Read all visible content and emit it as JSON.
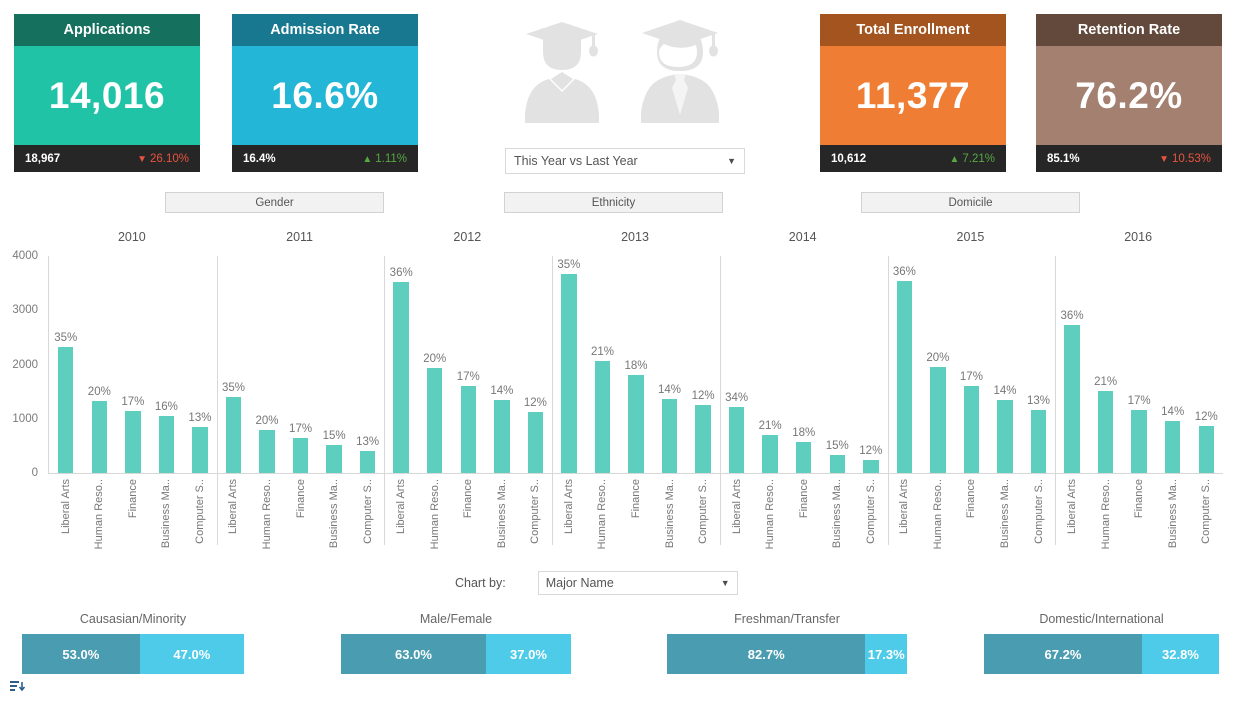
{
  "kpis": [
    {
      "title": "Applications",
      "value": "14,016",
      "prev": "18,967",
      "delta": "26.10%",
      "direction": "down",
      "head_color": "#15715e",
      "body_color": "#21c3a6",
      "delta_color": "#e8543f"
    },
    {
      "title": "Admission Rate",
      "value": "16.6%",
      "prev": "16.4%",
      "delta": "1.11%",
      "direction": "up",
      "head_color": "#17788f",
      "body_color": "#23b6d6",
      "delta_color": "#57a843"
    },
    {
      "title": "Total Enrollment",
      "value": "11,377",
      "prev": "10,612",
      "delta": "7.21%",
      "direction": "up",
      "head_color": "#a4541e",
      "body_color": "#f07d34",
      "delta_color": "#57a843"
    },
    {
      "title": "Retention Rate",
      "value": "76.2%",
      "prev": "85.1%",
      "delta": "10.53%",
      "direction": "down",
      "head_color": "#62493c",
      "body_color": "#a38070",
      "delta_color": "#e8543f"
    }
  ],
  "period_select": {
    "value": "This Year vs Last Year",
    "caret": "chevron-down-icon"
  },
  "filters": [
    {
      "label": "Gender"
    },
    {
      "label": "Ethnicity"
    },
    {
      "label": "Domicile"
    }
  ],
  "chart_by": {
    "label": "Chart by:",
    "value": "Major Name"
  },
  "splits": [
    {
      "title": "Causasian/Minority",
      "left_label": "53.0%",
      "right_label": "47.0%",
      "left_pct": 53.0,
      "right_pct": 47.0
    },
    {
      "title": "Male/Female",
      "left_label": "63.0%",
      "right_label": "37.0%",
      "left_pct": 63.0,
      "right_pct": 37.0
    },
    {
      "title": "Freshman/Transfer",
      "left_label": "82.7%",
      "right_label": "17.3%",
      "left_pct": 82.7,
      "right_pct": 17.3
    },
    {
      "title": "Domestic/International",
      "left_label": "67.2%",
      "right_label": "32.8%",
      "left_pct": 67.2,
      "right_pct": 32.8
    }
  ],
  "split_colors": {
    "left": "#4a9cb0",
    "right": "#4ecbe8"
  },
  "chart_data": {
    "type": "bar",
    "title": "",
    "xlabel": "",
    "ylabel": "",
    "ylim": [
      0,
      4000
    ],
    "yticks": [
      0,
      1000,
      2000,
      3000,
      4000
    ],
    "grid": false,
    "legend": "none",
    "bar_color": "#5ecfbe",
    "categories": [
      "Liberal Arts",
      "Human Reso..",
      "Finance",
      "Business Ma..",
      "Computer S.."
    ],
    "groups": [
      {
        "year": "2010",
        "values": [
          2330,
          1320,
          1140,
          1050,
          850
        ],
        "labels": [
          "35%",
          "20%",
          "17%",
          "16%",
          "13%"
        ]
      },
      {
        "year": "2011",
        "values": [
          1410,
          790,
          650,
          520,
          400
        ],
        "labels": [
          "35%",
          "20%",
          "17%",
          "15%",
          "13%"
        ]
      },
      {
        "year": "2012",
        "values": [
          3520,
          1930,
          1600,
          1340,
          1120
        ],
        "labels": [
          "36%",
          "20%",
          "17%",
          "14%",
          "12%"
        ]
      },
      {
        "year": "2013",
        "values": [
          3670,
          2070,
          1810,
          1360,
          1250
        ],
        "labels": [
          "35%",
          "21%",
          "18%",
          "14%",
          "12%"
        ]
      },
      {
        "year": "2014",
        "values": [
          1220,
          700,
          570,
          340,
          240
        ],
        "labels": [
          "34%",
          "21%",
          "18%",
          "15%",
          "12%"
        ]
      },
      {
        "year": "2015",
        "values": [
          3540,
          1950,
          1600,
          1340,
          1160
        ],
        "labels": [
          "36%",
          "20%",
          "17%",
          "14%",
          "13%"
        ]
      },
      {
        "year": "2016",
        "values": [
          2720,
          1510,
          1160,
          960,
          870
        ],
        "labels": [
          "36%",
          "21%",
          "17%",
          "14%",
          "12%"
        ]
      }
    ]
  }
}
